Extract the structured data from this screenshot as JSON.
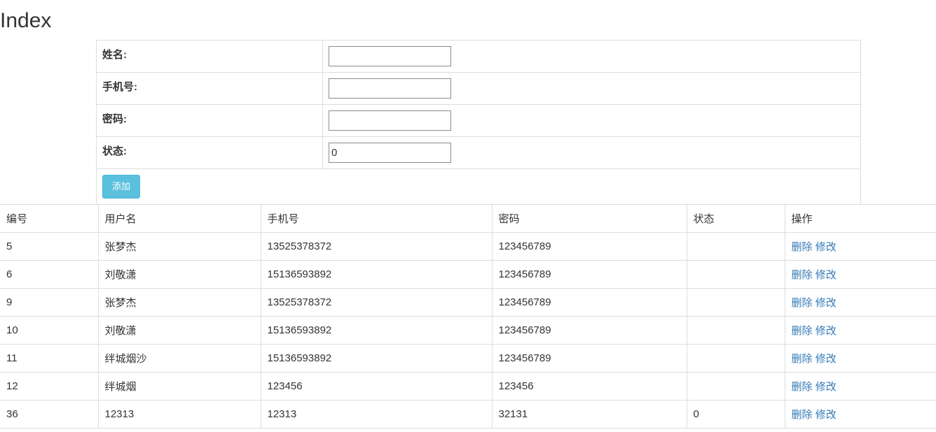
{
  "page": {
    "title": "Index"
  },
  "form": {
    "fields": [
      {
        "label": "姓名:",
        "value": ""
      },
      {
        "label": "手机号:",
        "value": ""
      },
      {
        "label": "密码:",
        "value": ""
      },
      {
        "label": "状态:",
        "value": "0"
      }
    ],
    "submit_label": "添加"
  },
  "table": {
    "headers": [
      "编号",
      "用户名",
      "手机号",
      "密码",
      "状态",
      "操作"
    ],
    "delete_label": "删除",
    "edit_label": "修改",
    "rows": [
      {
        "id": "5",
        "username": "张梦杰",
        "phone": "13525378372",
        "password": "123456789",
        "status": ""
      },
      {
        "id": "6",
        "username": "刘敬潇",
        "phone": "15136593892",
        "password": "123456789",
        "status": ""
      },
      {
        "id": "9",
        "username": "张梦杰",
        "phone": "13525378372",
        "password": "123456789",
        "status": ""
      },
      {
        "id": "10",
        "username": "刘敬潇",
        "phone": "15136593892",
        "password": "123456789",
        "status": ""
      },
      {
        "id": "11",
        "username": "绊城烟沙",
        "phone": "15136593892",
        "password": "123456789",
        "status": ""
      },
      {
        "id": "12",
        "username": "绊城烟",
        "phone": "123456",
        "password": "123456",
        "status": ""
      },
      {
        "id": "36",
        "username": "12313",
        "phone": "12313",
        "password": "32131",
        "status": "0"
      }
    ]
  },
  "colors": {
    "link": "#337ab7",
    "button_info": "#5bc0de",
    "border": "#dddddd"
  }
}
